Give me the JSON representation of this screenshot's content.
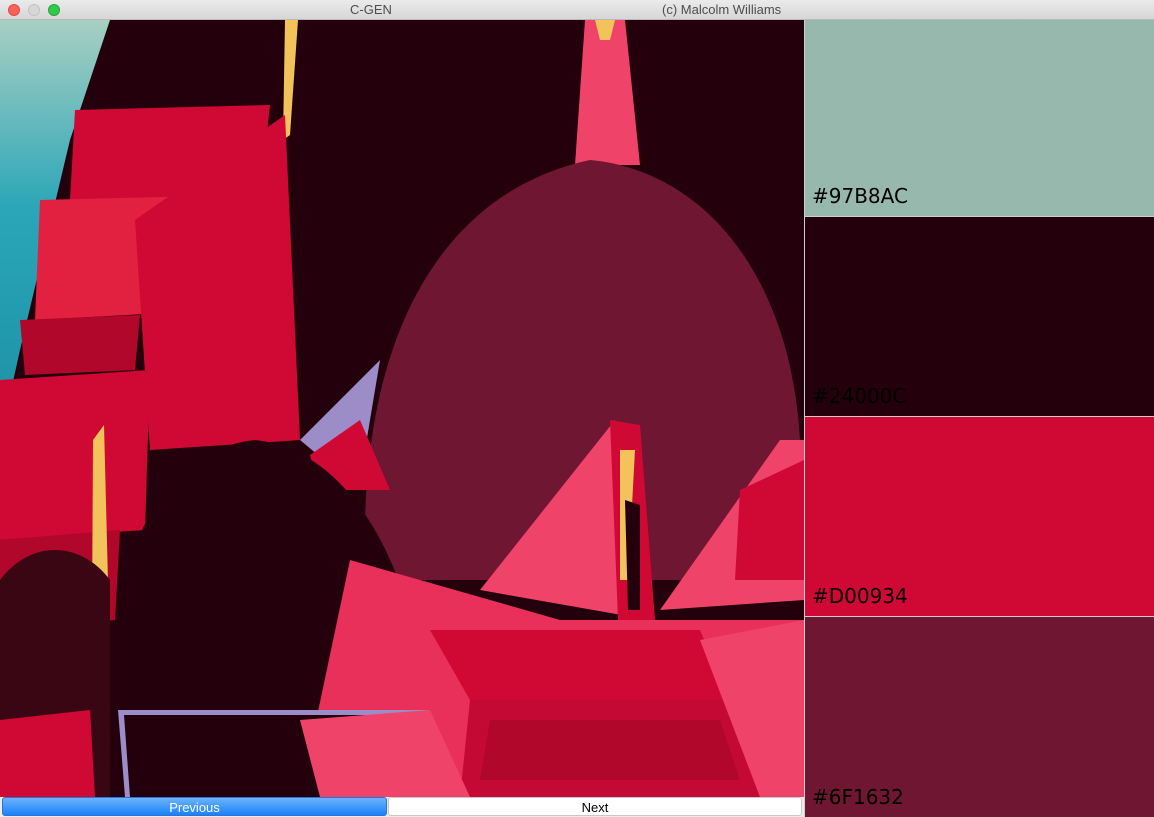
{
  "window": {
    "title": "C-GEN",
    "credit": "(c) Malcolm Williams"
  },
  "navigation": {
    "previous_label": "Previous",
    "next_label": "Next"
  },
  "palette": {
    "swatches": [
      {
        "hex": "#97B8AC",
        "color": "#97B8AC"
      },
      {
        "hex": "#24000C",
        "color": "#24000C"
      },
      {
        "hex": "#D00934",
        "color": "#D00934"
      },
      {
        "hex": "#6F1632",
        "color": "#6F1632"
      }
    ]
  },
  "artwork_colors": {
    "teal": "#2aa6b8",
    "mint": "#97b8ac",
    "dark": "#24000c",
    "red": "#d00934",
    "pink": "#f0436a",
    "plum": "#6f1632",
    "gold": "#f2c35a",
    "lavender": "#9c8cc8"
  }
}
